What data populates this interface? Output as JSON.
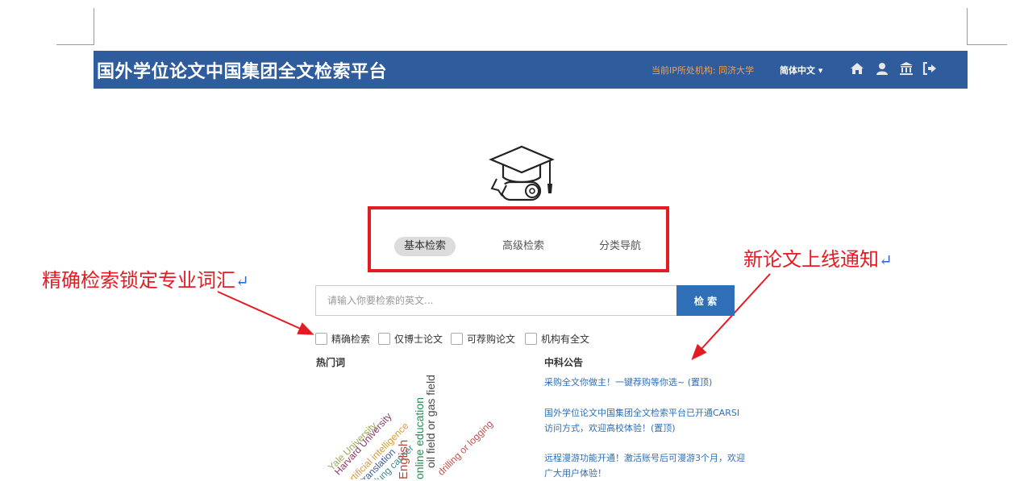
{
  "header": {
    "title": "国外学位论文中国集团全文检索平台",
    "ip_label": "当前IP所处机构: 同济大学",
    "language": "简体中文 ▾",
    "icons": [
      "home-icon",
      "user-icon",
      "institution-icon",
      "logout-icon"
    ]
  },
  "tabs": [
    {
      "label": "基本检索",
      "active": true
    },
    {
      "label": "高级检索",
      "active": false
    },
    {
      "label": "分类导航",
      "active": false
    }
  ],
  "annotations": {
    "left": "精确检索锁定专业词汇",
    "right": "新论文上线通知",
    "return_mark": "↵"
  },
  "search": {
    "placeholder": "请输入你要检索的英文...",
    "button_label": "检 索"
  },
  "options": [
    "精确检索",
    "仅博士论文",
    "可荐购论文",
    "机构有全文"
  ],
  "hotwords": {
    "title": "热门词",
    "words": [
      {
        "text": "Yale University",
        "color": "#9aa85a"
      },
      {
        "text": "Harvard University",
        "color": "#8b3a62"
      },
      {
        "text": "artificial intelligence",
        "color": "#d89a2c"
      },
      {
        "text": "translation",
        "color": "#3a5a9c"
      },
      {
        "text": "lung cancer",
        "color": "#3a8a8a"
      },
      {
        "text": "English",
        "color": "#b04a3a"
      },
      {
        "text": "online education",
        "color": "#2a8a5a"
      },
      {
        "text": "oil field or gas field",
        "color": "#4a4a4a"
      },
      {
        "text": "drilling or logging",
        "color": "#c0504d"
      }
    ]
  },
  "announcements": {
    "title": "中科公告",
    "items": [
      "采购全文你做主！一键荐购等你选~ (置顶)",
      "国外学位论文中国集团全文检索平台已开通CARSI访问方式，欢迎高校体验！(置顶)",
      "远程漫游功能开通！激活账号后可漫游3个月，欢迎广大用户体验！"
    ]
  },
  "colors": {
    "header_bg": "#2f5c9c",
    "accent_red": "#e41b23",
    "link_blue": "#2e6fb7"
  }
}
